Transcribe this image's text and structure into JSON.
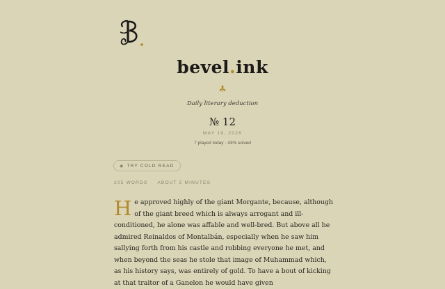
{
  "brand": {
    "name_prefix": "bevel",
    "name_dot": ".",
    "name_suffix": "ink",
    "tagline": "Daily literary deduction"
  },
  "puzzle": {
    "issue": "№ 12",
    "date": "MAY 19, 2026",
    "stats": "7 played today · 43% solved"
  },
  "actions": {
    "cold_read_label": "TRY COLD READ",
    "cold_read_icon": "eye-icon"
  },
  "meta": {
    "words": "205 WORDS",
    "time": "ABOUT 2 MINUTES"
  },
  "article": {
    "dropcap": "H",
    "body": "e approved highly of the giant Morgante, because, although of the giant breed which is always arrogant and ill-conditioned, he alone was affable and well-bred. But above all he admired Reinaldos of Montalbán, especially when he saw him sallying forth from his castle and robbing everyone he met, and when beyond the seas he stole that image of Muhammad which, as his history says, was entirely of gold. To have a bout of kicking at that traitor of a Ganelon he would have given"
  },
  "colors": {
    "background": "#dbd5b8",
    "accent": "#b08a2a",
    "text": "#1f1d18"
  }
}
